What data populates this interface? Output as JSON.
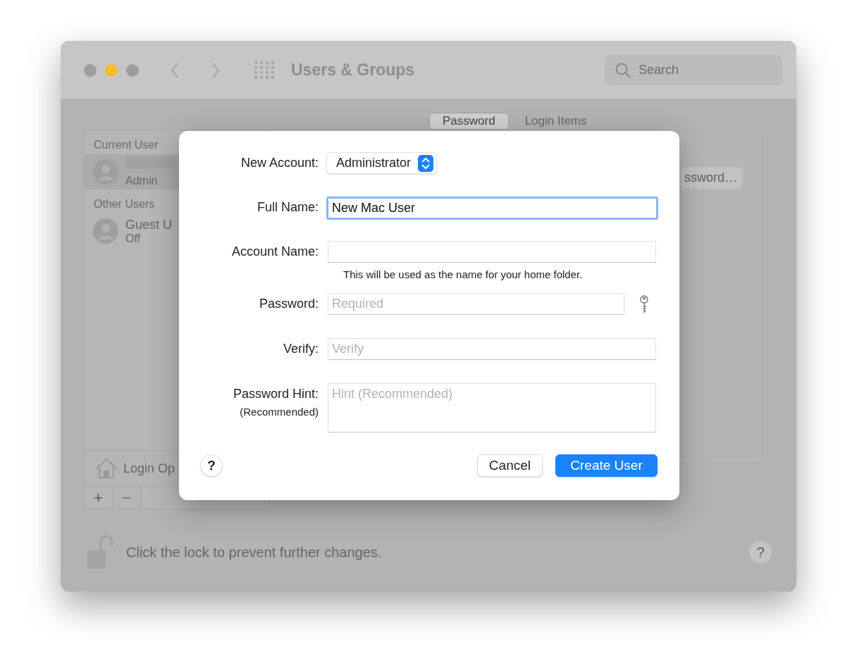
{
  "window": {
    "title": "Users & Groups",
    "search": {
      "placeholder": "Search"
    }
  },
  "sidebar": {
    "sections": [
      {
        "heading": "Current User",
        "users": [
          {
            "name_hidden": true,
            "role": "Admin",
            "selected": true
          }
        ]
      },
      {
        "heading": "Other Users",
        "users": [
          {
            "name": "Guest U",
            "role": "Off",
            "selected": false
          }
        ]
      }
    ],
    "login_options": "Login Op",
    "add_button": "+",
    "remove_button": "−"
  },
  "tabs": [
    {
      "label": "Password",
      "selected": true
    },
    {
      "label": "Login Items",
      "selected": false
    }
  ],
  "change_password_button": "ssword…",
  "lock": {
    "text": "Click the lock to prevent further changes.",
    "locked": false
  },
  "help_button": "?",
  "dialog": {
    "fields": [
      {
        "kind": "popup",
        "label": "New Account:",
        "value": "Administrator"
      },
      {
        "kind": "text",
        "label": "Full Name:",
        "value": "New Mac User",
        "focused": true
      },
      {
        "kind": "text",
        "label": "Account Name:",
        "focused": false,
        "note": "This will be used as the name for your home folder."
      },
      {
        "kind": "password",
        "label": "Password:",
        "placeholder": "Required",
        "focused": false
      },
      {
        "kind": "text",
        "label": "Verify:",
        "placeholder": "Verify",
        "focused": false
      },
      {
        "kind": "textarea",
        "label": "Password Hint:",
        "sublabel": "(Recommended)",
        "placeholder": "Hint (Recommended)",
        "focused": false
      }
    ],
    "help_button": "?",
    "buttons": [
      {
        "label": "Cancel",
        "default": false
      },
      {
        "label": "Create User",
        "default": true
      }
    ]
  }
}
